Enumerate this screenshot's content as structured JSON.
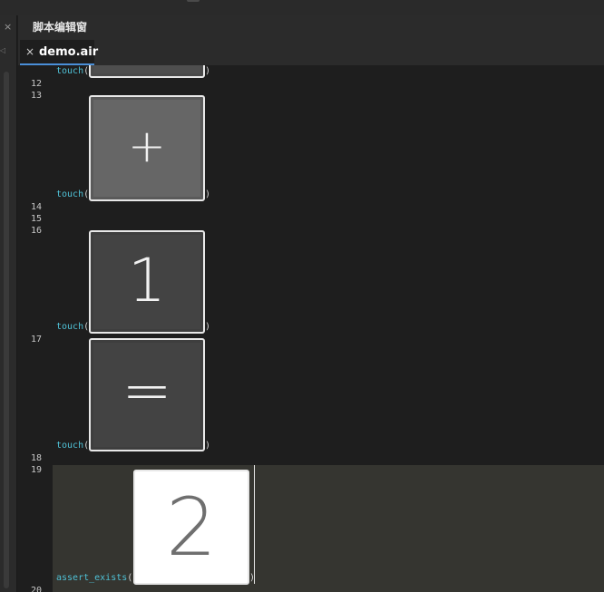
{
  "panel": {
    "title": "脚本编辑窗",
    "close_glyph": "×"
  },
  "tab": {
    "close_glyph": "×",
    "label": "demo.air",
    "accent_color": "#4a8fd8"
  },
  "editor": {
    "line_numbers": [
      "12",
      "13",
      "14",
      "15",
      "16",
      "17",
      "18",
      "19",
      "20"
    ],
    "calls": [
      {
        "fn": "touch",
        "open": "(",
        "close": ")"
      },
      {
        "fn": "touch",
        "open": "(",
        "close": ")"
      },
      {
        "fn": "touch",
        "open": "(",
        "close": ")"
      },
      {
        "fn": "touch",
        "open": "(",
        "close": ")"
      },
      {
        "fn": "assert_exists",
        "open": "(",
        "close": ")"
      }
    ],
    "thumbnails": {
      "plus": "+",
      "one": "1",
      "equals": "=",
      "two": "2"
    }
  },
  "colors": {
    "background": "#1e1e1e",
    "function_name": "#4fc1d6",
    "current_line": "#353530"
  }
}
